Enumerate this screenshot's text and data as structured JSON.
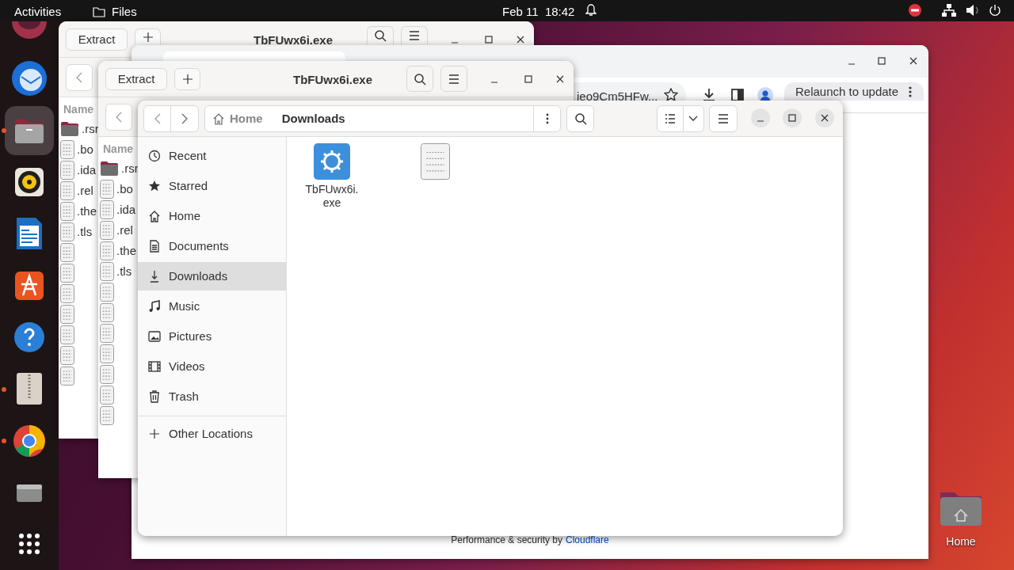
{
  "top_bar": {
    "activities": "Activities",
    "app": "Files",
    "clock": "Feb 11  18:42"
  },
  "dock": [
    {
      "kind": "browser",
      "running": false,
      "selected": false
    },
    {
      "kind": "mail",
      "running": false,
      "selected": false
    },
    {
      "kind": "files",
      "running": true,
      "selected": true
    },
    {
      "kind": "music",
      "running": false,
      "selected": false
    },
    {
      "kind": "writer",
      "running": false,
      "selected": false
    },
    {
      "kind": "store",
      "running": false,
      "selected": false
    },
    {
      "kind": "help",
      "running": false,
      "selected": false
    },
    {
      "kind": "archive",
      "running": true,
      "selected": false
    },
    {
      "kind": "chrome",
      "running": true,
      "selected": false
    },
    {
      "kind": "drive",
      "running": false,
      "selected": false
    },
    {
      "kind": "apps",
      "running": false,
      "selected": false
    }
  ],
  "archive_windows": [
    {
      "extract": "Extract",
      "title": "TbFUwx6i.exe",
      "column": "Name",
      "rows": [
        {
          "kind": "folder",
          "name": ".rsr"
        },
        {
          "kind": "binary",
          "name": ".bo"
        },
        {
          "kind": "binary",
          "name": ".ida"
        },
        {
          "kind": "binary",
          "name": ".rel"
        },
        {
          "kind": "binary",
          "name": ".the"
        },
        {
          "kind": "binary",
          "name": ".tls"
        },
        {
          "kind": "binary"
        },
        {
          "kind": "binary"
        },
        {
          "kind": "binary"
        },
        {
          "kind": "binary"
        },
        {
          "kind": "binary"
        },
        {
          "kind": "binary"
        },
        {
          "kind": "binary"
        }
      ]
    },
    {
      "extract": "Extract",
      "title": "TbFUwx6i.exe",
      "column": "Name",
      "rows": [
        {
          "kind": "folder",
          "name": ".rsr"
        },
        {
          "kind": "binary",
          "name": ".bo"
        },
        {
          "kind": "binary",
          "name": ".ida"
        },
        {
          "kind": "binary",
          "name": ".rel"
        },
        {
          "kind": "binary",
          "name": ".the"
        },
        {
          "kind": "binary",
          "name": ".tls"
        },
        {
          "kind": "binary"
        },
        {
          "kind": "binary"
        },
        {
          "kind": "binary"
        },
        {
          "kind": "binary"
        },
        {
          "kind": "binary"
        },
        {
          "kind": "binary"
        },
        {
          "kind": "binary"
        }
      ]
    }
  ],
  "browser": {
    "url": "jeo9Cm5HFw...",
    "relaunch": "Relaunch to update",
    "footer": "Performance & security by",
    "footer_link": "Cloudflare"
  },
  "files": {
    "path": [
      "Home",
      "Downloads"
    ],
    "sidebar": [
      {
        "kind": "recent",
        "label": "Recent",
        "selected": false
      },
      {
        "kind": "starred",
        "label": "Starred",
        "selected": false
      },
      {
        "kind": "home",
        "label": "Home",
        "selected": false
      },
      {
        "kind": "documents",
        "label": "Documents",
        "selected": false
      },
      {
        "kind": "downloads",
        "label": "Downloads",
        "selected": true
      },
      {
        "kind": "music",
        "label": "Music",
        "selected": false
      },
      {
        "kind": "pictures",
        "label": "Pictures",
        "selected": false
      },
      {
        "kind": "videos",
        "label": "Videos",
        "selected": false
      },
      {
        "kind": "trash",
        "label": "Trash",
        "selected": false
      }
    ],
    "other_locations": "Other Locations",
    "items": [
      {
        "kind": "executable",
        "name": "TbFUwx6i.\nexe"
      },
      {
        "kind": "binary"
      }
    ]
  },
  "desktop_icons": [
    {
      "kind": "home",
      "label": "Home"
    }
  ]
}
